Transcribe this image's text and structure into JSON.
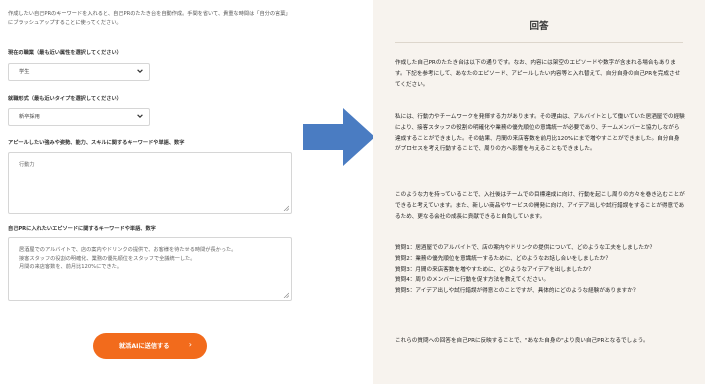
{
  "form": {
    "intro": "作成したい自己PRのキーワードを入れると、自己PRのたたき台を自動作成。手間を省いて、貴重な時間は「自分の言葉」にブラッシュアップすることに使ってください。",
    "job_label": "現在の職業（最も近い属性を選択してください）",
    "job_value": "学生",
    "employment_label": "就職形式（最も近いタイプを選択してください）",
    "employment_value": "新卒採用",
    "appeal_label": "アピールしたい強みや姿勢、能力、スキルに関するキーワードや単語、数字",
    "appeal_value": "行動力",
    "episode_label": "自己PRに入れたいエピソードに関するキーワードや単語、数字",
    "episode_value": "居酒屋でのアルバイトで、店の案内やドリンクの提供で、お客様を待たせる時間が長かった。\n接客スタッフの役割の明確化、業務の優先順位をスタッフで全議統一した。\n月間の来店客数を、前月比120%にできた。",
    "submit_label": "就活AIに送信する",
    "submit_arrow": "›"
  },
  "answer": {
    "title": "回答",
    "p1": "作成した自己PRのたたき台は以下の通りです。なお、内容には架空のエピソードや数字が含まれる場合もあります。下記を参考にして、あなたのエピソード、アピールしたい内容等と入れ替えて、自分自身の自己PRを完成させてください。",
    "p2": "私には、行動力やチームワークを発揮する力があります。その理由は、アルバイトとして働いていた居酒屋での経験により、接客スタッフの役割の明確化や業務の優先順位の意識統一が必要であり、チームメンバーと協力しながら達成することができました。その結果、月間の来店客数を前月比120%にまで増やすことができました。自分自身がプロセスを考え行動することで、周りの方へ影響を与えることもできました。",
    "p3": "このような力を持っていることで、入社後はチームでの目標達成に向け、行動を起こし周りの方々を巻き込むことができると考えています。また、新しい商品やサービスの開発に向け、アイデア出しや試行錯誤をすることが得意であるため、更なる会社の成長に貢献できると自負しています。",
    "questions": [
      "質問1：居酒屋でのアルバイトで、店の案内やドリンクの提供について、どのような工夫をしましたか？",
      "質問2：業務の優先順位を意識統一するために、どのようなお話し合いをしましたか？",
      "質問3：月間の来店客数を増やすために、どのようなアイデアを出しましたか？",
      "質問4：周りのメンバーに行動を促す方法を教えてください。",
      "質問5：アイデア出しや試行錯誤が得意とのことですが、具体的にどのような経験がありますか？"
    ],
    "closing": "これらの質問への回答を自己PRに反映することで、\"あなた自身の\"より良い自己PRとなるでしょう。"
  },
  "colors": {
    "accent": "#f26b1c",
    "arrow": "#4a7cc2",
    "answer_bg": "#f7f3ee"
  }
}
